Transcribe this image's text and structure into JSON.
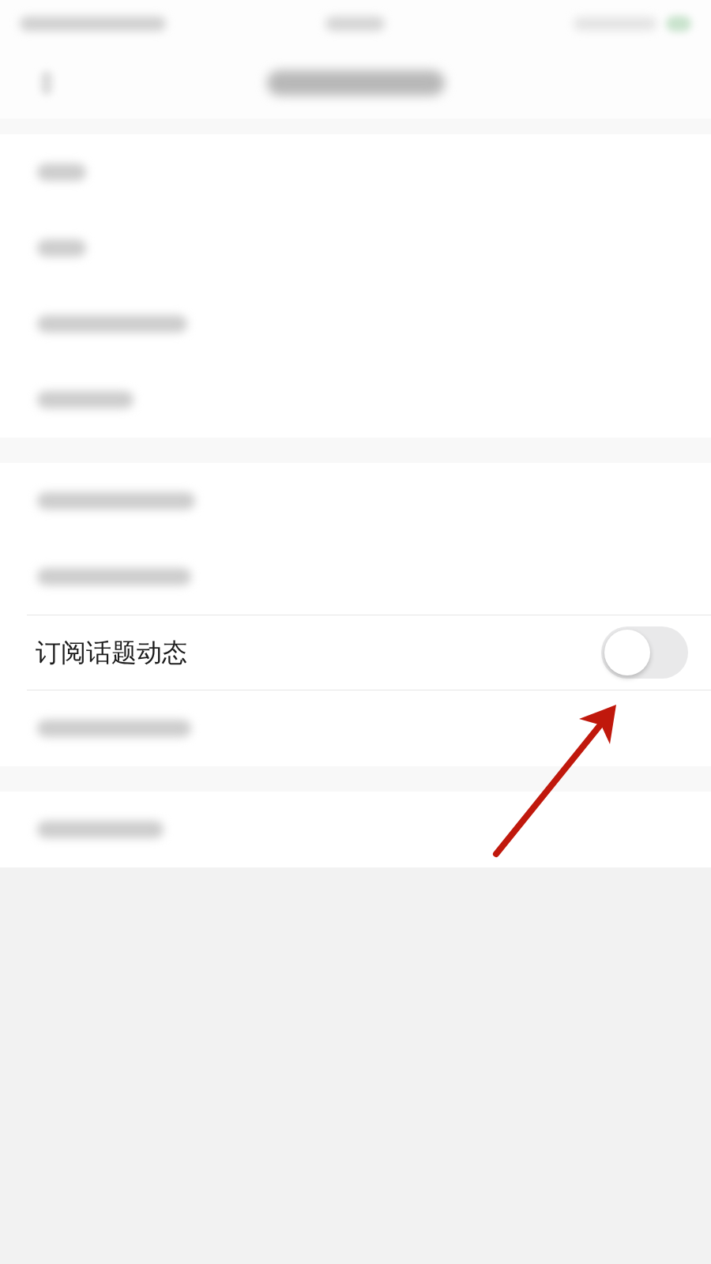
{
  "sections": [
    {
      "rows": [
        {
          "kind": "blurred"
        },
        {
          "kind": "blurred"
        },
        {
          "kind": "blurred"
        },
        {
          "kind": "blurred"
        }
      ]
    },
    {
      "rows": [
        {
          "kind": "blurred"
        },
        {
          "kind": "blurred"
        },
        {
          "kind": "toggle",
          "label": "订阅话题动态",
          "on": false
        },
        {
          "kind": "blurred"
        }
      ]
    },
    {
      "rows": [
        {
          "kind": "blurred"
        }
      ]
    }
  ],
  "annotations": [
    {
      "kind": "arrow"
    }
  ]
}
